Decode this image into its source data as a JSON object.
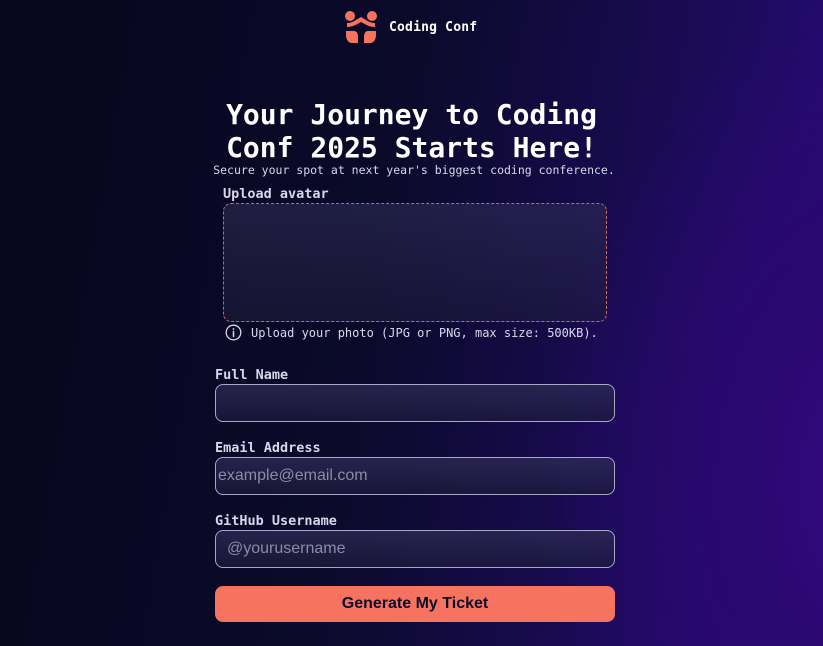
{
  "brand": {
    "name": "Coding Conf",
    "logo_icon": "coding-conf-logo-icon",
    "accent_color": "#f5735f"
  },
  "hero": {
    "title_line1": "Your Journey to Coding",
    "title_line2": "Conf 2025 Starts Here!",
    "subtitle": "Secure your spot at next year's biggest coding conference."
  },
  "form": {
    "avatar": {
      "label": "Upload avatar",
      "hint": "Upload your photo (JPG or PNG, max size: 500KB).",
      "hint_icon": "info-icon"
    },
    "full_name": {
      "label": "Full Name",
      "value": "",
      "placeholder": ""
    },
    "email": {
      "label": "Email Address",
      "value": "",
      "placeholder": "example@email.com"
    },
    "github": {
      "label": "GitHub Username",
      "value": "",
      "placeholder": "@yourusername"
    },
    "submit_label": "Generate My Ticket"
  }
}
